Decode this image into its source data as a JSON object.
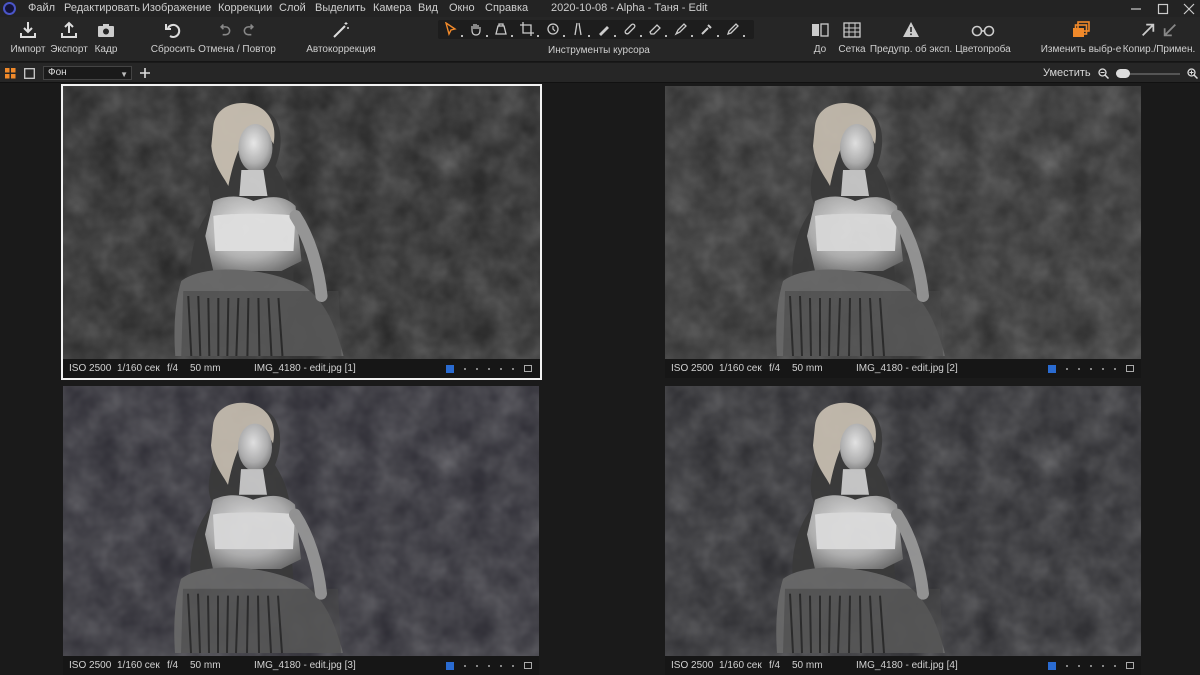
{
  "window": {
    "title": "2020-10-08 - Alpha - Таня - Edit"
  },
  "menu": [
    "Файл",
    "Редактировать",
    "Изображение",
    "Коррекции",
    "Слой",
    "Выделить",
    "Камера",
    "Вид",
    "Окно",
    "Справка"
  ],
  "toolbar": {
    "import": "Импорт",
    "export": "Экспорт",
    "frame": "Кадр",
    "reset": "Сбросить",
    "undo_redo": "Отмена / Повтор",
    "auto": "Автокоррекция",
    "cursor_tools": "Инструменты курсора",
    "before": "До",
    "grid": "Сетка",
    "exposure_warning": "Предупр. об эксп.",
    "color_picker": "Цветопроба",
    "edit_selection": "Изменить выбр-е",
    "copy_apply": "Копир./Примен."
  },
  "secondbar": {
    "layer": "Фон",
    "fit": "Уместить"
  },
  "colors": {
    "accent_orange": "#f0892a",
    "rating_blue": "#2a6bd1",
    "selection_border": "#f2f2f2"
  },
  "variants": [
    {
      "iso": "ISO 2500",
      "shutter": "1/160 сек",
      "aperture": "f/4",
      "focal": "50 mm",
      "filename": "IMG_4180 - edit.jpg [1]",
      "selected": true
    },
    {
      "iso": "ISO 2500",
      "shutter": "1/160 сек",
      "aperture": "f/4",
      "focal": "50 mm",
      "filename": "IMG_4180 - edit.jpg [2]",
      "selected": false
    },
    {
      "iso": "ISO 2500",
      "shutter": "1/160 сек",
      "aperture": "f/4",
      "focal": "50 mm",
      "filename": "IMG_4180 - edit.jpg [3]",
      "selected": false
    },
    {
      "iso": "ISO 2500",
      "shutter": "1/160 сек",
      "aperture": "f/4",
      "focal": "50 mm",
      "filename": "IMG_4180 - edit.jpg [4]",
      "selected": false
    }
  ]
}
